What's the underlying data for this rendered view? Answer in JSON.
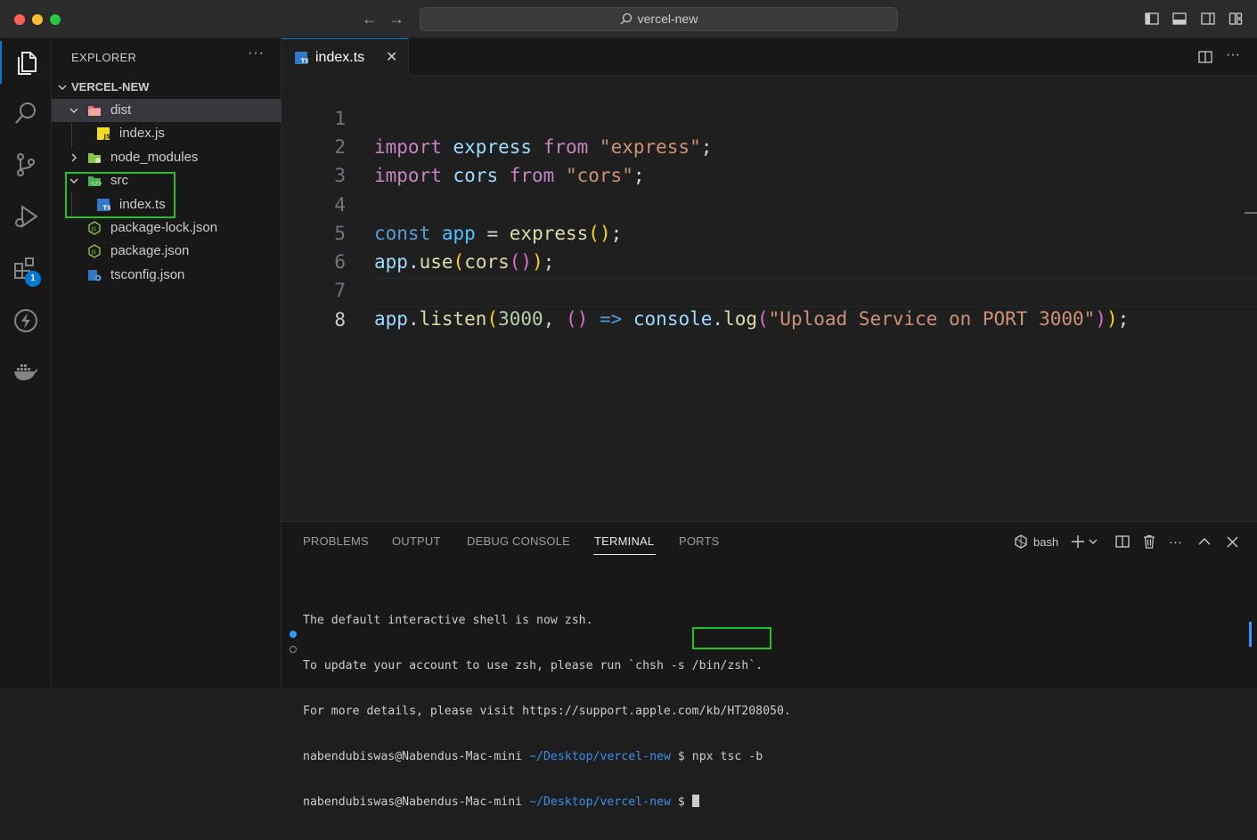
{
  "window": {
    "search_text": "vercel-new",
    "nav_back_icon": "arrow-left-icon",
    "nav_forward_icon": "arrow-right-icon"
  },
  "activity_bar": {
    "items": [
      "explorer",
      "search",
      "source-control",
      "run-and-debug",
      "extensions",
      "thunder-client",
      "docker"
    ],
    "extensions_badge": "1"
  },
  "sidebar": {
    "title": "EXPLORER",
    "more": "···",
    "root": "VERCEL-NEW",
    "tree": [
      {
        "label": "dist",
        "type": "folder",
        "expanded": true
      },
      {
        "label": "index.js",
        "type": "js"
      },
      {
        "label": "node_modules",
        "type": "folder",
        "expanded": false
      },
      {
        "label": "src",
        "type": "folder",
        "expanded": true
      },
      {
        "label": "index.ts",
        "type": "ts"
      },
      {
        "label": "package-lock.json",
        "type": "json"
      },
      {
        "label": "package.json",
        "type": "json"
      },
      {
        "label": "tsconfig.json",
        "type": "tsconfig"
      }
    ]
  },
  "editor": {
    "tab_label": "index.ts",
    "tab_close": "✕",
    "line_numbers": [
      "1",
      "2",
      "3",
      "4",
      "5",
      "6",
      "7",
      "8"
    ],
    "current_line": "8",
    "lines": [
      "import express from \"express\";",
      "import cors from \"cors\";",
      "",
      "const app = express();",
      "app.use(cors());",
      "",
      "app.listen(3000, () => console.log(\"Upload Service on PORT 3000\"));",
      ""
    ]
  },
  "panel": {
    "tabs": [
      "PROBLEMS",
      "OUTPUT",
      "DEBUG CONSOLE",
      "TERMINAL",
      "PORTS"
    ],
    "active_tab": "TERMINAL",
    "shell_name": "bash",
    "terminal": {
      "messages": [
        "The default interactive shell is now zsh.",
        "To update your account to use zsh, please run `chsh -s /bin/zsh`.",
        "For more details, please visit https://support.apple.com/kb/HT208050."
      ],
      "user_host": "nabendubiswas@Nabendus-Mac-mini",
      "path": "~/Desktop/vercel-new",
      "prompt_symbol": "$",
      "command": "npx tsc -b"
    }
  },
  "colors": {
    "highlight_box": "#22c322",
    "accent": "#0078d4",
    "editor_bg": "#1f1f1f"
  }
}
